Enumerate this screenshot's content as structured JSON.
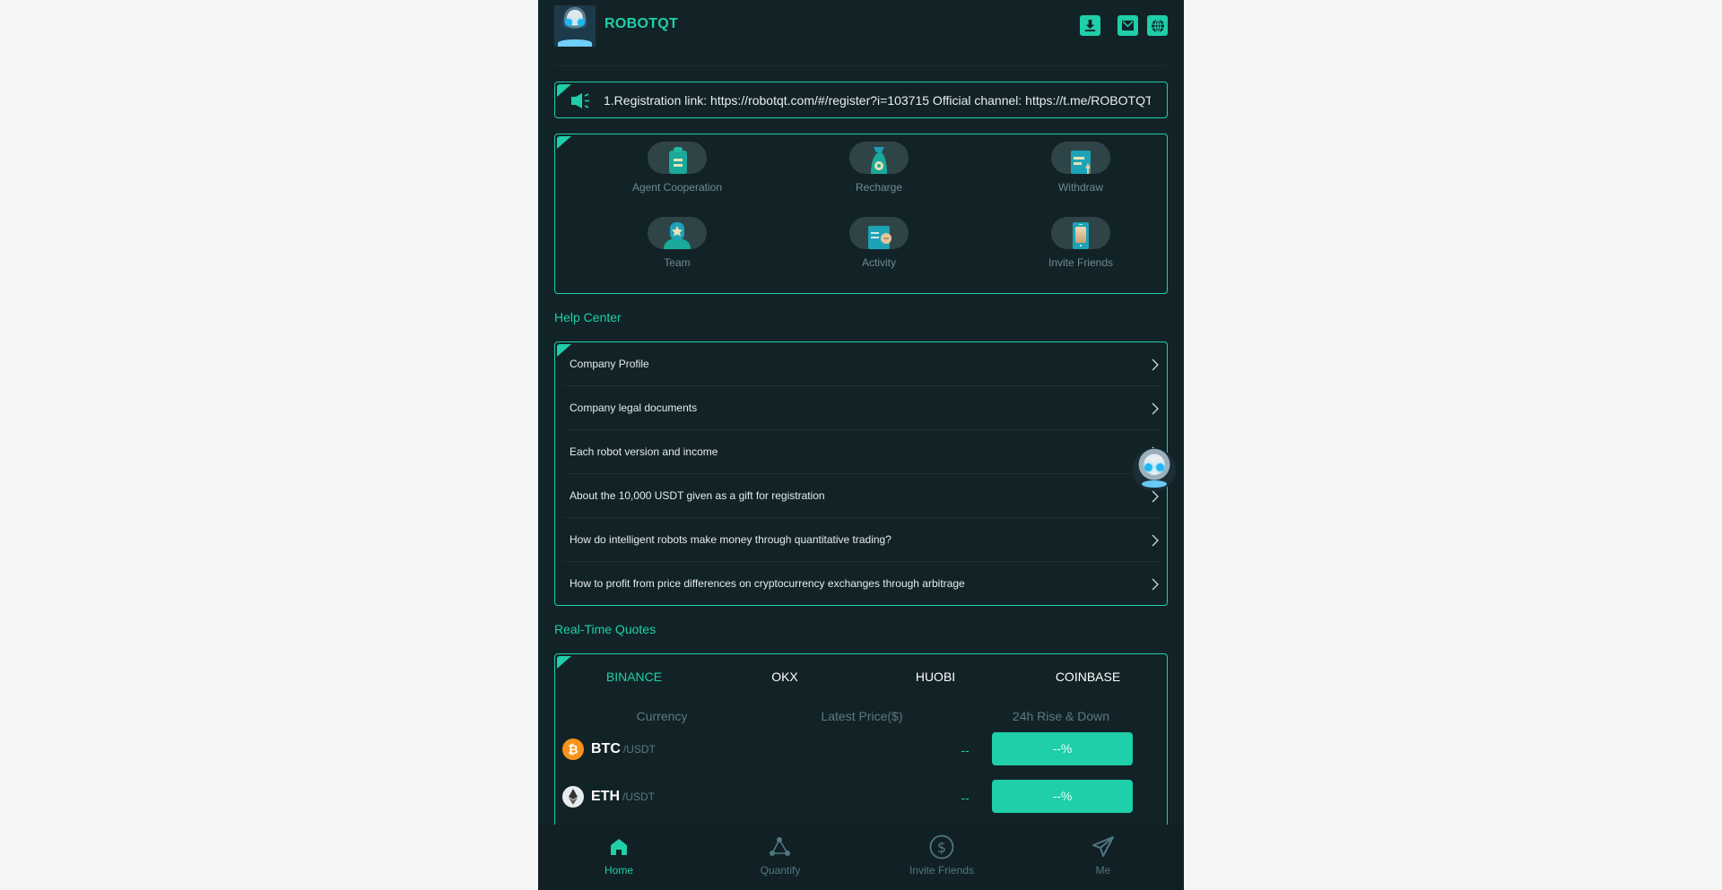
{
  "header": {
    "brand": "ROBOTQT",
    "icons": [
      "download-icon",
      "mail-icon",
      "globe-icon"
    ]
  },
  "notice": {
    "icon": "speaker-icon",
    "text": "1.Registration link: https://robotqt.com/#/register?i=103715 Official channel: https://t.me/ROBOTQT"
  },
  "features": [
    {
      "label": "Agent Cooperation",
      "icon": "agent-cooperation-icon"
    },
    {
      "label": "Recharge",
      "icon": "money-bag-icon"
    },
    {
      "label": "Withdraw",
      "icon": "withdraw-icon"
    },
    {
      "label": "Team",
      "icon": "team-icon"
    },
    {
      "label": "Activity",
      "icon": "activity-icon"
    },
    {
      "label": "Invite Friends",
      "icon": "phone-icon"
    }
  ],
  "help_center": {
    "title": "Help Center",
    "items": [
      "Company Profile",
      "Company legal documents",
      "Each robot version and income",
      "About the 10,000 USDT given as a gift for registration",
      "How do intelligent robots make money through quantitative trading?",
      "How to profit from price differences on cryptocurrency exchanges through arbitrage"
    ]
  },
  "quotes": {
    "title": "Real-Time Quotes",
    "tabs": [
      "BINANCE",
      "OKX",
      "HUOBI",
      "COINBASE"
    ],
    "active_tab": "BINANCE",
    "columns": [
      "Currency",
      "Latest Price($)",
      "24h Rise & Down"
    ],
    "rows": [
      {
        "symbol": "BTC",
        "pair": "/USDT",
        "price": "--",
        "change": "--%",
        "icon": "bitcoin-icon"
      },
      {
        "symbol": "ETH",
        "pair": "/USDT",
        "price": "--",
        "change": "--%",
        "icon": "ethereum-icon"
      }
    ]
  },
  "bottom_nav": [
    {
      "label": "Home",
      "icon": "home-icon",
      "active": true
    },
    {
      "label": "Quantify",
      "icon": "network-icon",
      "active": false
    },
    {
      "label": "Invite Friends",
      "icon": "dollar-circle-icon",
      "active": false
    },
    {
      "label": "Me",
      "icon": "paper-plane-icon",
      "active": false
    }
  ],
  "colors": {
    "accent": "#1ecfa9",
    "background": "#122327",
    "muted_text": "#6f8a93",
    "btc": "#f7931a"
  }
}
